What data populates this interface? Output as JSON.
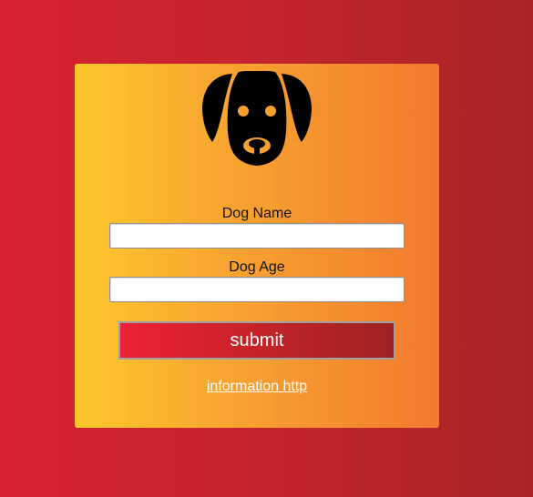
{
  "form": {
    "logo_icon": "dog-head-icon",
    "dog_name_label": "Dog Name",
    "dog_name_value": "",
    "dog_age_label": "Dog Age",
    "dog_age_value": "",
    "submit_label": "submit",
    "info_link_label": "information http"
  },
  "colors": {
    "page_background": "#c2242d",
    "card_gradient_start": "#fdc72c",
    "card_gradient_end": "#f2792f",
    "button_gradient_start": "#ec2236",
    "button_gradient_end": "#9d2222",
    "logo": "#000000",
    "dog_eyes": "#f7a230"
  }
}
